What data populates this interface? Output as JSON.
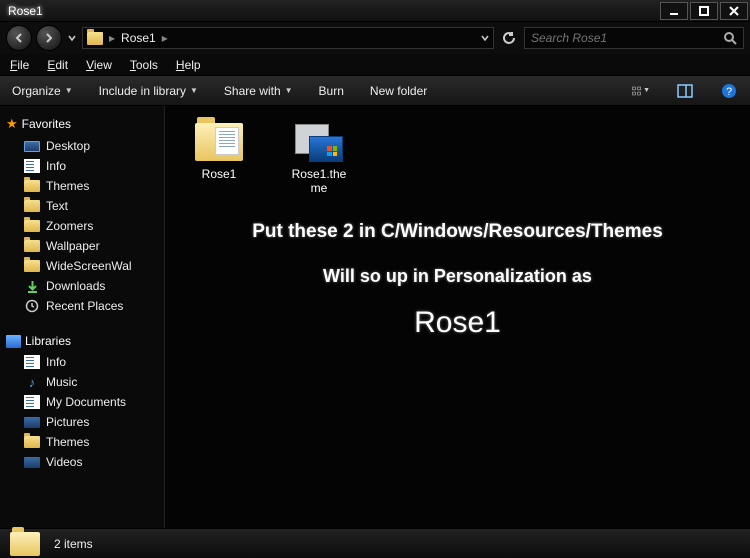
{
  "window": {
    "title": "Rose1"
  },
  "address": {
    "folder_name": "Rose1",
    "separator": "▸"
  },
  "search": {
    "placeholder": "Search Rose1"
  },
  "menu": {
    "file": "File",
    "edit": "Edit",
    "view": "View",
    "tools": "Tools",
    "help": "Help"
  },
  "toolbar": {
    "organize": "Organize",
    "include": "Include in library",
    "share": "Share with",
    "burn": "Burn",
    "newfolder": "New folder"
  },
  "sidebar": {
    "favorites_label": "Favorites",
    "favorites": [
      {
        "label": "Desktop",
        "icon": "desktop"
      },
      {
        "label": "Info",
        "icon": "doc"
      },
      {
        "label": "Themes",
        "icon": "folder"
      },
      {
        "label": "Text",
        "icon": "folder"
      },
      {
        "label": "Zoomers",
        "icon": "folder"
      },
      {
        "label": "Wallpaper",
        "icon": "folder"
      },
      {
        "label": "WideScreenWal",
        "icon": "folder"
      },
      {
        "label": "Downloads",
        "icon": "download"
      },
      {
        "label": "Recent Places",
        "icon": "recent"
      }
    ],
    "libraries_label": "Libraries",
    "libraries": [
      {
        "label": "Info",
        "icon": "doc"
      },
      {
        "label": "Music",
        "icon": "music"
      },
      {
        "label": "My Documents",
        "icon": "doc"
      },
      {
        "label": "Pictures",
        "icon": "pic"
      },
      {
        "label": "Themes",
        "icon": "folder"
      },
      {
        "label": "Videos",
        "icon": "pic"
      }
    ]
  },
  "content": {
    "items": [
      {
        "label": "Rose1",
        "kind": "folder"
      },
      {
        "label": "Rose1.theme",
        "kind": "theme"
      }
    ],
    "overlay": {
      "line1": "Put these 2 in C/Windows/Resources/Themes",
      "line2": "Will so up in Personalization as",
      "line3": "Rose1"
    }
  },
  "status": {
    "count": "2 items"
  }
}
